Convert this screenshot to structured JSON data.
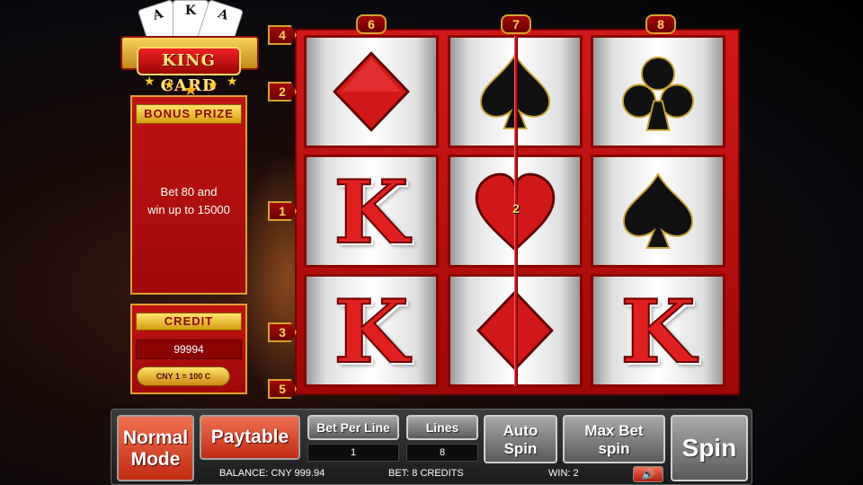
{
  "logo": {
    "title": "KING CARD",
    "cards": [
      "A",
      "K",
      "A"
    ]
  },
  "bonus": {
    "label": "BONUS PRIZE",
    "line1": "Bet 80 and",
    "line2": "win up to 15000"
  },
  "credit": {
    "label": "CREDIT",
    "value": "99994",
    "rate": "CNY 1 = 100 C"
  },
  "line_markers": {
    "left": [
      "4",
      "2",
      "1",
      "3",
      "5"
    ],
    "top": [
      "6",
      "7",
      "8"
    ]
  },
  "reels": [
    [
      "diamond",
      "spade",
      "club"
    ],
    [
      "king",
      "heart",
      "spade"
    ],
    [
      "king",
      "diamond",
      "king"
    ]
  ],
  "king_letter": "K",
  "win_line": {
    "count": "2"
  },
  "controls": {
    "normal_mode": [
      "Normal",
      "Mode"
    ],
    "paytable": "Paytable",
    "bet_per_line_label": "Bet Per Line",
    "bet_per_line_value": "1",
    "lines_label": "Lines",
    "lines_value": "8",
    "auto_spin": [
      "Auto",
      "Spin"
    ],
    "max_bet_spin": [
      "Max Bet",
      "spin"
    ],
    "spin": "Spin",
    "sound_icon": "speaker-icon"
  },
  "status": {
    "balance": "BALANCE: CNY 999.94",
    "bet": "BET: 8 CREDITS",
    "win": "WIN: 2"
  },
  "colors": {
    "frame": "#c01212",
    "gold": "#e0a030",
    "suit_red": "#d01818",
    "suit_black": "#111111"
  }
}
